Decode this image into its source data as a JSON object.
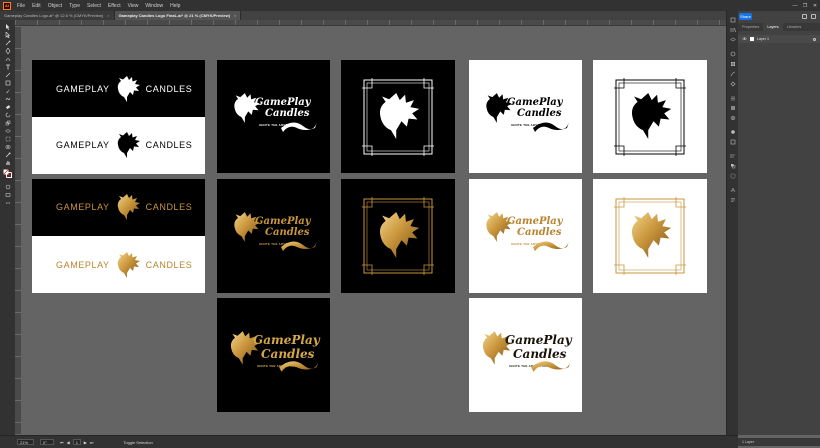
{
  "menu": {
    "app_logo": "Ai",
    "items": [
      "File",
      "Edit",
      "Object",
      "Type",
      "Select",
      "Effect",
      "View",
      "Window",
      "Help"
    ],
    "window_controls": [
      "—",
      "❐",
      "✕"
    ]
  },
  "tabs": [
    {
      "label": "Gameplay Candles Logo.ai* @ 12.5 % (CMYK/Preview)",
      "close": "×"
    },
    {
      "label": "Gameplay Candles Logo FinaL.ai* @ 21 % (CMYK/Preview)",
      "close": "×"
    }
  ],
  "panel": {
    "share_label": "Share",
    "tabs": [
      "Properties",
      "Layers",
      "Libraries"
    ],
    "layer_name": "Layer 1",
    "footer": "1 Layer"
  },
  "artwork": {
    "wordmark_left": "GAMEPLAY",
    "wordmark_right": "CANDLES",
    "script_line1": "GameP",
    "script_line1b": "lay",
    "script_line2": "Candles",
    "tagline": "IGNITE THE ADVENTURE"
  },
  "status": {
    "zoom": "21%",
    "rotation": "0°",
    "artboard_number": "1",
    "tool_hint": "Toggle Selection"
  },
  "icons": {
    "menu_logo": "illustrator-logo-icon",
    "dragon": "dragon-head-icon",
    "eye": "eye-icon"
  },
  "colors": {
    "gold": "#c9963c",
    "share_blue": "#1473e6",
    "ai_orange": "#ff9a00"
  }
}
